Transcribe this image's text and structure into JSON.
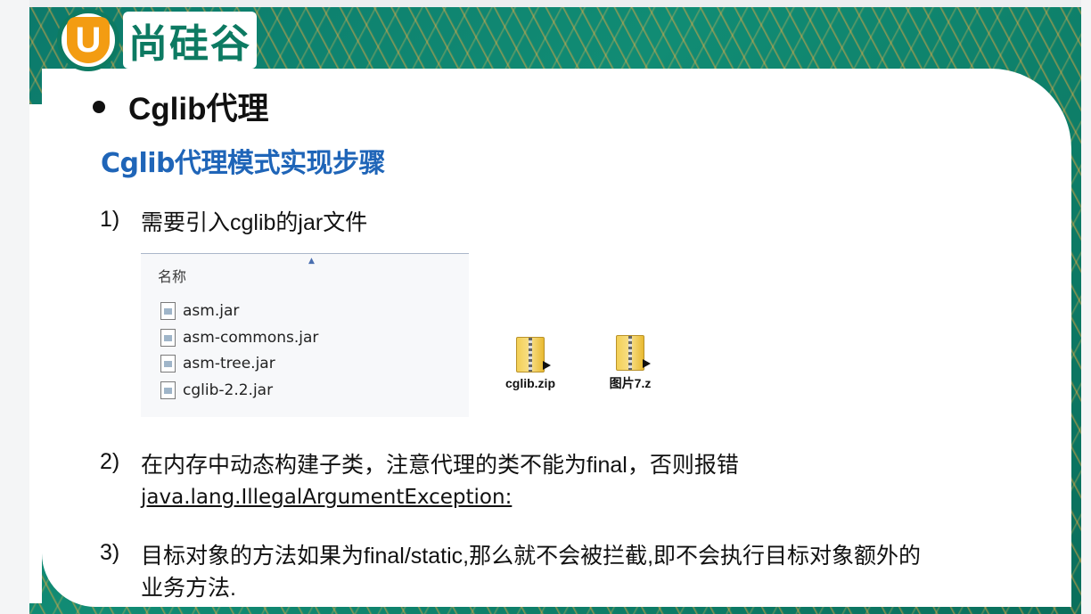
{
  "logo": {
    "letter": "U",
    "text": "尚硅谷"
  },
  "heading": {
    "title": "Cglib代理"
  },
  "subtitle": "Cglib代理模式实现步骤",
  "steps": [
    {
      "num": "1)",
      "text": "需要引入cglib的jar文件"
    },
    {
      "num": "2)",
      "line1": "在内存中动态构建子类，注意代理的类不能为final，否则报错",
      "link": "java.lang.IllegalArgumentException:"
    },
    {
      "num": "3)",
      "line1": "目标对象的方法如果为final/static,那么就不会被拦截,即不会执行目标对象额外的",
      "line2": "业务方法."
    }
  ],
  "explorer": {
    "column_header": "名称",
    "files": [
      "asm.jar",
      "asm-commons.jar",
      "asm-tree.jar",
      "cglib-2.2.jar"
    ]
  },
  "desktop_items": [
    {
      "label": "cglib.zip",
      "icon": "zip-folder-icon"
    },
    {
      "label": "图片7.z",
      "icon": "zip-folder-icon"
    }
  ]
}
